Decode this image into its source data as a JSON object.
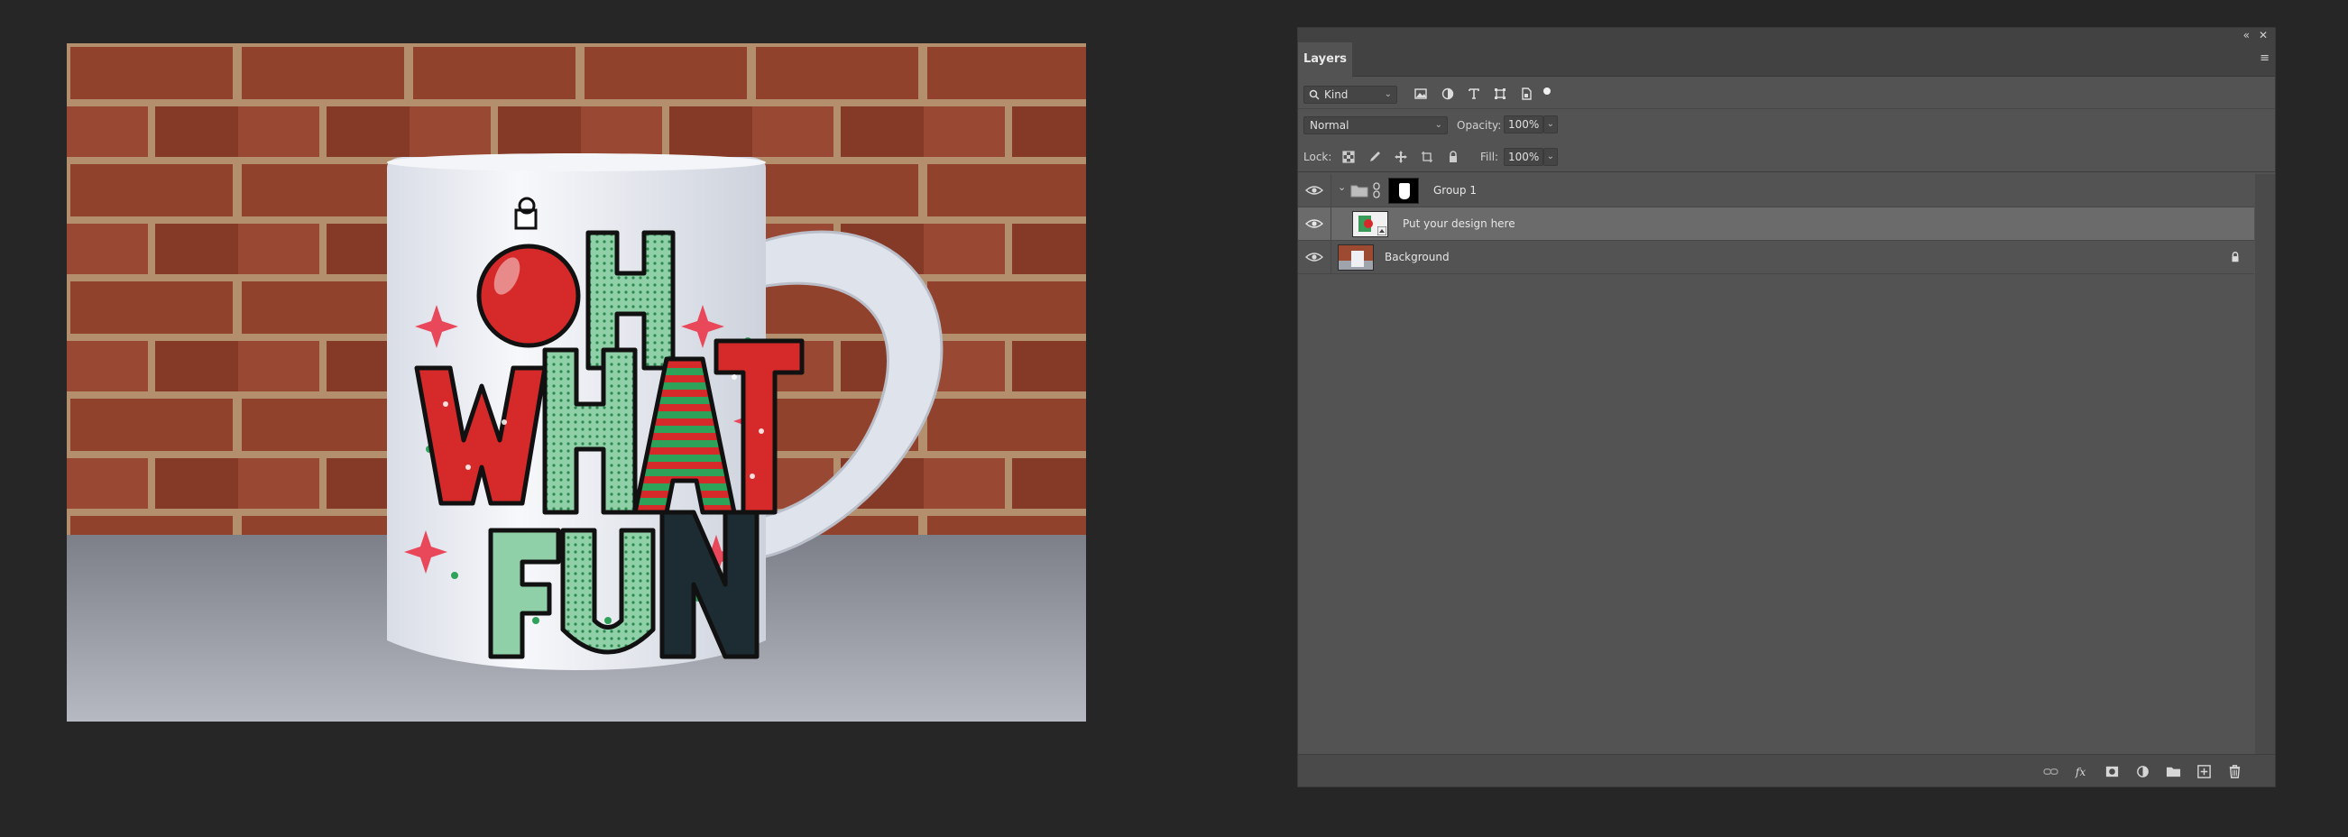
{
  "canvas": {
    "image_alt": "white ceramic mug with OH WHAT FUN christmas design in front of brick wall",
    "design_text": [
      "OH",
      "WHAT",
      "FUN"
    ]
  },
  "panel": {
    "tab_label": "Layers",
    "filter": {
      "kind_label": "Kind"
    },
    "blend": {
      "mode": "Normal",
      "opacity_label": "Opacity:",
      "opacity_value": "100%"
    },
    "lock": {
      "lock_label": "Lock:",
      "fill_label": "Fill:",
      "fill_value": "100%"
    },
    "layers": [
      {
        "name": "Group 1",
        "type": "group",
        "visible": true
      },
      {
        "name": "Put your design here",
        "type": "smart-object",
        "visible": true,
        "selected": true
      },
      {
        "name": "Background",
        "type": "pixel",
        "visible": true,
        "locked": true
      }
    ]
  },
  "colors": {
    "app_bg": "#262626",
    "panel_bg": "#535353",
    "selected_row": "#6b6b6b",
    "brick": "#9c4a34",
    "mug": "#e9ecf2",
    "ornament_red": "#d62a2a",
    "green": "#2fa25a"
  }
}
